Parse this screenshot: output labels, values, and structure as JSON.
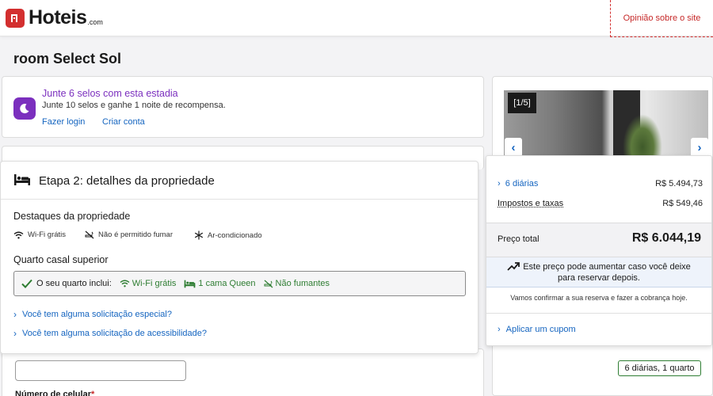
{
  "header": {
    "logo_text": "Hoteis",
    "logo_suffix": ".com",
    "feedback_link": "Opinião sobre o site"
  },
  "page": {
    "title": "room Select Sol"
  },
  "rewards": {
    "icon": "moon-icon",
    "title": "Junte 6 selos com esta estadia",
    "subtitle": "Junte 10 selos e ganhe 1 noite de recompensa.",
    "login_link": "Fazer login",
    "signup_link": "Criar conta"
  },
  "details": {
    "icon": "bed-icon",
    "title": "Etapa 2: detalhes da propriedade",
    "highlights_title": "Destaques da propriedade",
    "highlights": [
      {
        "icon": "wifi-icon",
        "label": "Wi-Fi grátis"
      },
      {
        "icon": "no-smoking-icon",
        "label": "Não é permitido fumar"
      },
      {
        "icon": "snowflake-icon",
        "label": "Ar-condicionado"
      }
    ],
    "room_title": "Quarto casal superior",
    "includes_label": "O seu quarto inclui:",
    "includes": [
      {
        "icon": "wifi-icon",
        "label": "Wi-Fi grátis"
      },
      {
        "icon": "bed-icon",
        "label": "1 cama Queen"
      },
      {
        "icon": "no-smoking-icon",
        "label": "Não fumantes"
      }
    ],
    "special_request_link": "Você tem alguma solicitação especial?",
    "accessibility_link": "Você tem alguma solicitação de acessibilidade?"
  },
  "form": {
    "phone_label": "Número de celular",
    "required_mark": "*"
  },
  "gallery": {
    "counter": "[1/5]"
  },
  "price": {
    "nights_label": "6 diárias",
    "nights_value": "R$ 5.494,73",
    "taxes_label": "Impostos e taxas",
    "taxes_value": "R$ 549,46",
    "total_label": "Preço total",
    "total_value": "R$ 6.044,19",
    "alert_line1": "Este preço pode aumentar caso você deixe",
    "alert_line2": "para reservar depois.",
    "confirm_note": "Vamos confirmar a sua reserva e fazer a cobrança hoje.",
    "coupon_link": "Aplicar um cupom"
  },
  "summary": {
    "stay": "6 diárias, 1 quarto"
  },
  "colors": {
    "brand_red": "#d32f2f",
    "rewards_purple": "#7b2fbe",
    "link_blue": "#1565c0",
    "included_green": "#2e7d32"
  }
}
